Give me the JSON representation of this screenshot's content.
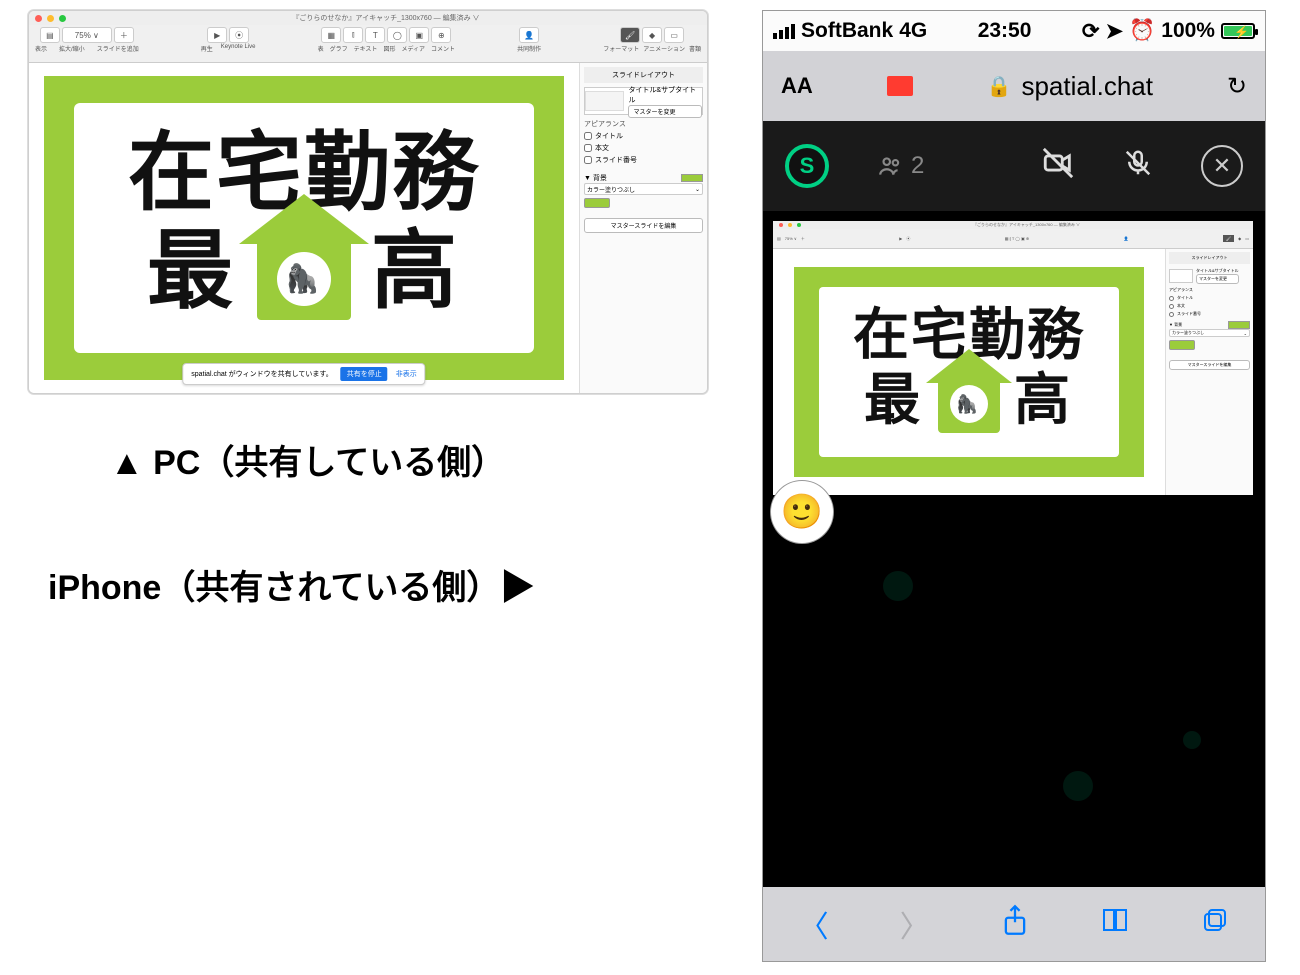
{
  "keynote": {
    "title": "『ごりらのせなか』アイキャッチ_1300x760 — 編集済み ∨",
    "toolbar": {
      "view": "表示",
      "zoom": "75% ∨",
      "zoomLabel": "拡大/縮小",
      "addSlide": "スライドを追加",
      "addIcon": "＋",
      "play": "▶",
      "playLabel": "再生",
      "live": "⦿",
      "liveLabel": "Keynote Live",
      "table": "表",
      "chart": "グラフ",
      "text": "テキスト",
      "shape": "図形",
      "media": "メディア",
      "comment": "コメント",
      "collab": "共同制作",
      "format": "フォーマット",
      "animate": "アニメーション",
      "document": "書類"
    },
    "slide": {
      "top": "在宅勤務",
      "botLeft": "最",
      "botRight": "高"
    },
    "share": {
      "msg": "spatial.chat がウィンドウを共有しています。",
      "stop": "共有を停止",
      "hide": "非表示"
    },
    "inspector": {
      "layout": "スライドレイアウト",
      "titleSub": "タイトル&サブタイトル",
      "changeMaster": "マスターを変更",
      "appearance": "アピアランス",
      "chkTitle": "タイトル",
      "chkBody": "本文",
      "chkNumber": "スライド番号",
      "bg": "背景",
      "fill": "カラー塗りつぶし",
      "editMaster": "マスタースライドを編集"
    }
  },
  "captions": {
    "pc": "▲ PC（共有している側）",
    "iphone": "iPhone（共有されている側）▶"
  },
  "iphone": {
    "carrier": "SoftBank",
    "network": "4G",
    "time": "23:50",
    "battery": "100%",
    "url": "spatial.chat",
    "participants": "2"
  }
}
